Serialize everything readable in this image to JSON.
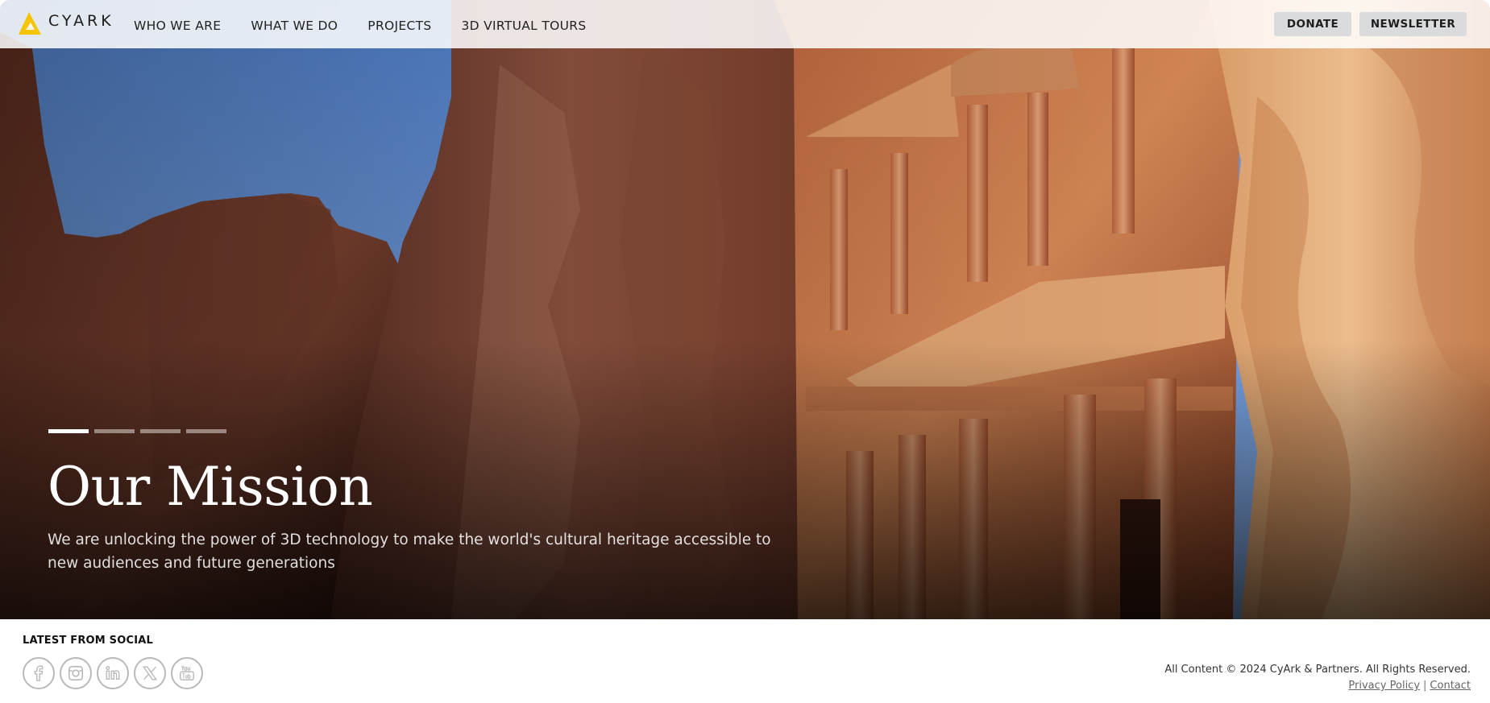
{
  "brand": {
    "name": "CYARK",
    "logo_icon": "cyark-logo-icon"
  },
  "nav": {
    "items": [
      {
        "label": "WHO WE ARE"
      },
      {
        "label": "WHAT WE DO"
      },
      {
        "label": "PROJECTS"
      },
      {
        "label": "3D VIRTUAL TOURS"
      }
    ]
  },
  "header_buttons": {
    "donate": "DONATE",
    "newsletter": "NEWSLETTER"
  },
  "hero": {
    "slides_total": 4,
    "active_slide": 1,
    "title": "Our Mission",
    "text": "We are unlocking the power of 3D technology to make the world's cultural heritage accessible to new audiences and future generations"
  },
  "footer": {
    "social_heading": "LATEST FROM SOCIAL",
    "social_icons": [
      "facebook-icon",
      "instagram-icon",
      "linkedin-icon",
      "x-icon",
      "youtube-icon"
    ],
    "copyright": "All Content © 2024 CyArk & Partners. All Rights Reserved.",
    "links": {
      "privacy": "Privacy Policy",
      "separator": "|",
      "contact": "Contact"
    }
  },
  "colors": {
    "logo_yellow": "#f5c400",
    "indicator_active": "#ffffff",
    "social_gray": "#b9b9b9"
  }
}
